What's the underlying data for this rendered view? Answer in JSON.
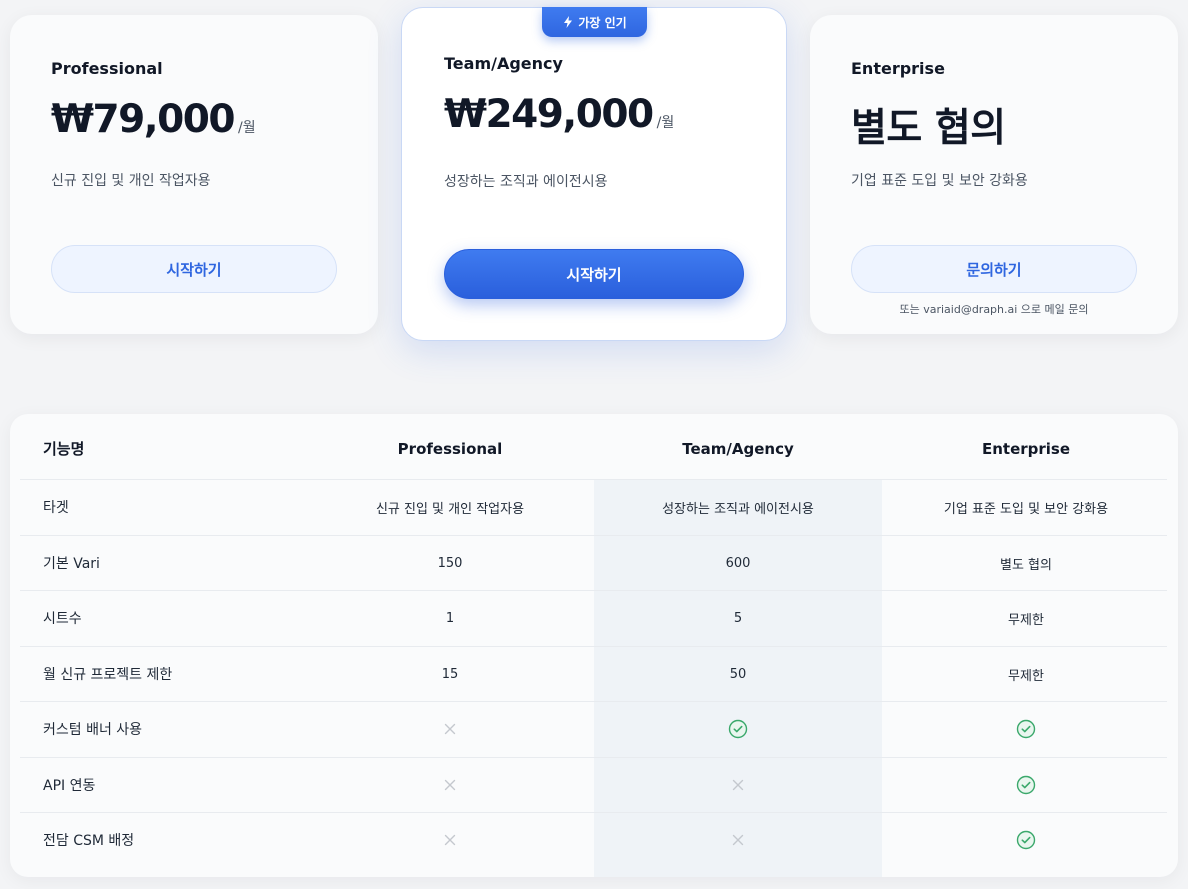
{
  "plans": {
    "professional": {
      "name": "Professional",
      "price": "₩79,000",
      "per": "/월",
      "desc": "신규 진입 및 개인 작업자용",
      "button": "시작하기"
    },
    "team": {
      "badge": "가장 인기",
      "name": "Team/Agency",
      "price": "₩249,000",
      "per": "/월",
      "desc": "성장하는 조직과 에이전시용",
      "button": "시작하기"
    },
    "enterprise": {
      "name": "Enterprise",
      "price": "별도 협의",
      "desc": "기업 표준 도입 및 보안 강화용",
      "button": "문의하기",
      "note": "또는 variaid@draph.ai 으로 메일 문의"
    }
  },
  "table": {
    "headers": [
      "기능명",
      "Professional",
      "Team/Agency",
      "Enterprise"
    ],
    "rows": [
      {
        "label": "타겟",
        "values": [
          "신규 진입 및 개인 작업자용",
          "성장하는 조직과 에이전시용",
          "기업 표준 도입 및 보안 강화용"
        ]
      },
      {
        "label": "기본 Vari",
        "values": [
          "150",
          "600",
          "별도 협의"
        ]
      },
      {
        "label": "시트수",
        "values": [
          "1",
          "5",
          "무제한"
        ]
      },
      {
        "label": "월 신규 프로젝트 제한",
        "values": [
          "15",
          "50",
          "무제한"
        ]
      },
      {
        "label": "커스텀 배너 사용",
        "values": [
          "x-icon",
          "check-icon",
          "check-icon"
        ]
      },
      {
        "label": "API 연동",
        "values": [
          "x-icon",
          "x-icon",
          "check-icon"
        ]
      },
      {
        "label": "전담 CSM 배정",
        "values": [
          "x-icon",
          "x-icon",
          "check-icon"
        ]
      }
    ]
  },
  "colors": {
    "accent": "#2f66e0",
    "check": "#3aa86b",
    "cross": "#c4c8ce"
  }
}
